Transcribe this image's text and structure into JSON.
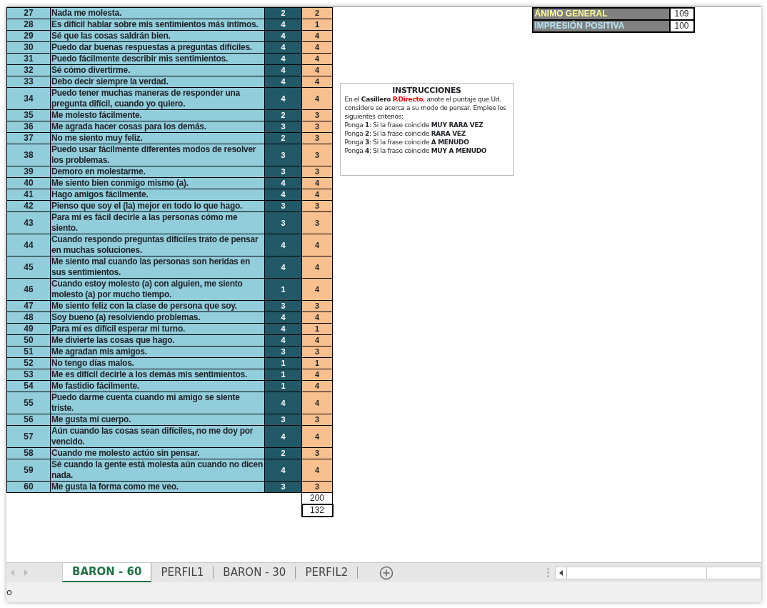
{
  "items": [
    {
      "number": "27",
      "text": "Nada me molesta.",
      "score": "2",
      "direct": "2"
    },
    {
      "number": "28",
      "text": "Es difícil hablar sobre mis sentimientos más íntimos.",
      "score": "4",
      "direct": "1"
    },
    {
      "number": "29",
      "text": "Sé que las cosas saldrán bien.",
      "score": "4",
      "direct": "4"
    },
    {
      "number": "30",
      "text": "Puedo dar buenas respuestas a preguntas difíciles.",
      "score": "4",
      "direct": "4"
    },
    {
      "number": "31",
      "text": "Puedo fácilmente describir mis sentimientos.",
      "score": "4",
      "direct": "4"
    },
    {
      "number": "32",
      "text": "Sé cómo divertirme.",
      "score": "4",
      "direct": "4"
    },
    {
      "number": "33",
      "text": "Debo decir siempre la verdad.",
      "score": "4",
      "direct": "4"
    },
    {
      "number": "34",
      "text": "Puedo tener muchas maneras de responder una pregunta difícil, cuando yo quiero.",
      "score": "4",
      "direct": "4"
    },
    {
      "number": "35",
      "text": "Me molesto fácilmente.",
      "score": "2",
      "direct": "3"
    },
    {
      "number": "36",
      "text": "Me agrada hacer cosas para los demás.",
      "score": "3",
      "direct": "3"
    },
    {
      "number": "37",
      "text": "No me siento muy feliz.",
      "score": "2",
      "direct": "3"
    },
    {
      "number": "38",
      "text": "Puedo usar fácilmente diferentes modos de resolver los problemas.",
      "score": "3",
      "direct": "3"
    },
    {
      "number": "39",
      "text": "Demoro en molestarme.",
      "score": "3",
      "direct": "3"
    },
    {
      "number": "40",
      "text": "Me siento bien conmigo mismo (a).",
      "score": "4",
      "direct": "4"
    },
    {
      "number": "41",
      "text": "Hago amigos fácilmente.",
      "score": "4",
      "direct": "4"
    },
    {
      "number": "42",
      "text": "Pienso que soy el (la) mejor en todo lo que hago.",
      "score": "3",
      "direct": "3"
    },
    {
      "number": "43",
      "text": "Para mí es fácil decirle a las personas cómo me siento.",
      "score": "3",
      "direct": "3"
    },
    {
      "number": "44",
      "text": "Cuando respondo preguntas difíciles trato de pensar en muchas soluciones.",
      "score": "4",
      "direct": "4"
    },
    {
      "number": "45",
      "text": "Me siento mal cuando las personas son heridas en sus sentimientos.",
      "score": "4",
      "direct": "4"
    },
    {
      "number": "46",
      "text": "Cuando estoy molesto (a) con alguien, me siento molesto (a) por mucho tiempo.",
      "score": "1",
      "direct": "4"
    },
    {
      "number": "47",
      "text": "Me siento feliz con la clase de persona que soy.",
      "score": "3",
      "direct": "3"
    },
    {
      "number": "48",
      "text": "Soy bueno (a) resolviendo problemas.",
      "score": "4",
      "direct": "4"
    },
    {
      "number": "49",
      "text": "Para mí es difícil esperar mi turno.",
      "score": "4",
      "direct": "1"
    },
    {
      "number": "50",
      "text": "Me divierte las cosas que hago.",
      "score": "4",
      "direct": "4"
    },
    {
      "number": "51",
      "text": "Me agradan mis amigos.",
      "score": "3",
      "direct": "3"
    },
    {
      "number": "52",
      "text": "No tengo días malos.",
      "score": "1",
      "direct": "1"
    },
    {
      "number": "53",
      "text": "Me es difícil decirle a los demás mis sentimientos.",
      "score": "1",
      "direct": "4"
    },
    {
      "number": "54",
      "text": "Me fastidio fácilmente.",
      "score": "1",
      "direct": "4"
    },
    {
      "number": "55",
      "text": "Puedo darme cuenta cuando mi amigo se siente triste.",
      "score": "4",
      "direct": "4"
    },
    {
      "number": "56",
      "text": "Me gusta mi cuerpo.",
      "score": "3",
      "direct": "3"
    },
    {
      "number": "57",
      "text": "Aún cuando las cosas sean difíciles, no me doy por vencido.",
      "score": "4",
      "direct": "4"
    },
    {
      "number": "58",
      "text": "Cuando me molesto actúo sin pensar.",
      "score": "2",
      "direct": "3"
    },
    {
      "number": "59",
      "text": "Sé cuando la gente está molesta aún cuando no dicen nada.",
      "score": "4",
      "direct": "4"
    },
    {
      "number": "60",
      "text": "Me gusta la forma como me veo.",
      "score": "3",
      "direct": "3"
    }
  ],
  "totals": [
    "200",
    "132"
  ],
  "summary": [
    {
      "label": "ÁNIMO GENERAL",
      "value": "109",
      "kind": "mood"
    },
    {
      "label": "IMPRESIÓN POSITIVA",
      "value": "100",
      "kind": "impression"
    }
  ],
  "instructions": {
    "title": "INSTRUCCIONES",
    "intro_before": "En el **Casillero**",
    "intro_highlight": "P.Directo",
    "intro_after": ", anote el puntaje que Ud. considere se acerca a su modo de pensar. Emplee los siguientes criterios:",
    "criteria": [
      "Ponga **1**: Si la frase coincide **MUY RARA VEZ**",
      "Ponga **2**: Si la frase coincide **RARA VEZ**",
      "Ponga **3**: Si la frase coincide **A MENUDO**",
      "Ponga **4**: Si la frase coincide **MUY A MENUDO**"
    ]
  },
  "sheet_tabs": [
    {
      "label": "BARON - 60",
      "selected": true
    },
    {
      "label": "PERFIL1",
      "selected": false
    },
    {
      "label": "BARON - 30",
      "selected": false
    },
    {
      "label": "PERFIL2",
      "selected": false
    }
  ],
  "status_bar": "o"
}
